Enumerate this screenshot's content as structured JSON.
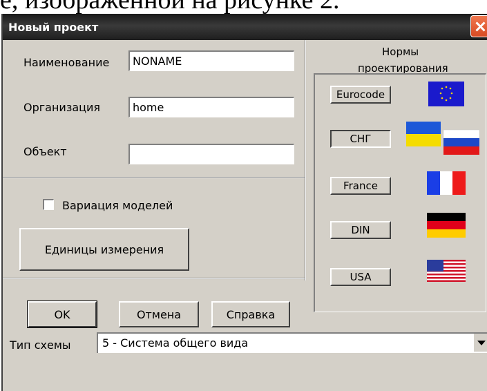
{
  "caption": "е, изображенной на рисунке 2.",
  "window": {
    "title": "Новый проект"
  },
  "form": {
    "name_label": "Наименование",
    "name_value": "NONAME",
    "org_label": "Организация",
    "org_value": "home",
    "object_label": "Объект",
    "object_value": ""
  },
  "variation": {
    "label": "Вариация моделей",
    "checked": false
  },
  "units_button": "Единицы измерения",
  "dialog_buttons": {
    "ok": "OK",
    "cancel": "Отмена",
    "help": "Справка"
  },
  "norms": {
    "heading_line1": "Нормы",
    "heading_line2": "проектирования",
    "items": [
      {
        "label": "Eurocode",
        "flag": "eu-flag-icon",
        "selected": false
      },
      {
        "label": "СНГ",
        "flag": "ukraine-russia-flag-icon",
        "selected": true
      },
      {
        "label": "France",
        "flag": "france-flag-icon",
        "selected": false
      },
      {
        "label": "DIN",
        "flag": "germany-flag-icon",
        "selected": false
      },
      {
        "label": "USA",
        "flag": "usa-flag-icon",
        "selected": false
      }
    ]
  },
  "scheme": {
    "label": "Тип схемы",
    "value": "5  - Система общего вида"
  }
}
